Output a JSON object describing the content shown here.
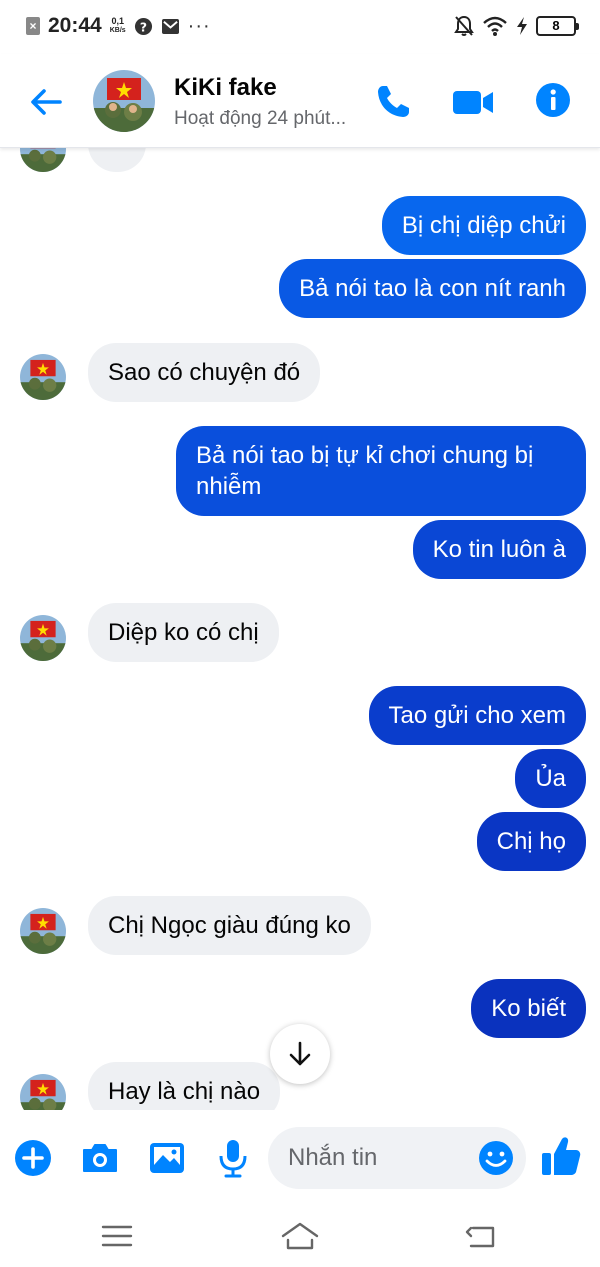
{
  "status_bar": {
    "time": "20:44",
    "net_speed_value": "0,1",
    "net_speed_unit": "KB/s",
    "more": "···",
    "battery": "8"
  },
  "header": {
    "contact_name": "KiKi fake",
    "contact_status": "Hoạt động 24 phút..."
  },
  "colors": {
    "accent": "#0084ff",
    "bubble_out_top": "#0a6bf0",
    "bubble_out_bottom": "#0a2fb5",
    "bubble_in": "#eef0f3"
  },
  "messages": [
    {
      "side": "out",
      "text": "Bị chị diệp chửi"
    },
    {
      "side": "out",
      "text": "Bả nói tao là con nít ranh"
    },
    {
      "side": "in",
      "text": "Sao có chuyện đó"
    },
    {
      "side": "out",
      "text": "Bả nói tao bị tự kỉ chơi chung bị nhiễm"
    },
    {
      "side": "out",
      "text": "Ko tin luôn à"
    },
    {
      "side": "in",
      "text": "Diệp ko có chị"
    },
    {
      "side": "out",
      "text": "Tao gửi cho xem"
    },
    {
      "side": "out",
      "text": "Ủa"
    },
    {
      "side": "out",
      "text": "Chị họ"
    },
    {
      "side": "in",
      "text": "Chị Ngọc giàu đúng ko"
    },
    {
      "side": "out",
      "text": "Ko biết"
    },
    {
      "side": "in",
      "text": "Hay là chị nào"
    }
  ],
  "composer": {
    "placeholder": "Nhắn tin"
  },
  "icons": {
    "header": [
      "back-arrow-icon",
      "phone-icon",
      "video-camera-icon",
      "info-icon"
    ],
    "composer": [
      "plus-icon",
      "camera-icon",
      "image-icon",
      "microphone-icon",
      "emoji-icon",
      "like-icon"
    ],
    "nav": [
      "menu-icon",
      "home-icon",
      "back-icon"
    ]
  }
}
